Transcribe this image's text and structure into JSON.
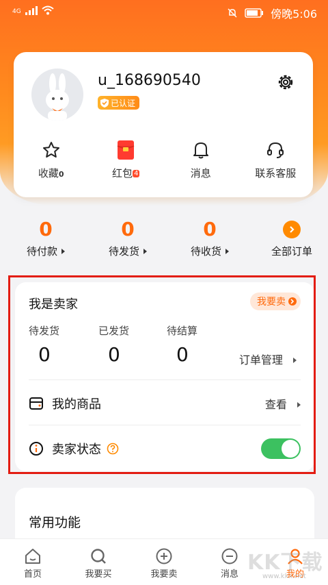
{
  "status_bar": {
    "network": "4G",
    "time": "傍晚5:06"
  },
  "profile": {
    "username": "u_168690540",
    "verified_label": "已认证"
  },
  "quick_actions": [
    {
      "label": "收藏",
      "count": "0",
      "icon": "star-icon"
    },
    {
      "label": "红包",
      "count": "4",
      "icon": "red-envelope-icon"
    },
    {
      "label": "消息",
      "count": "",
      "icon": "bell-icon"
    },
    {
      "label": "联系客服",
      "count": "",
      "icon": "headset-icon"
    }
  ],
  "orders": [
    {
      "count": "0",
      "label": "待付款"
    },
    {
      "count": "0",
      "label": "待发货"
    },
    {
      "count": "0",
      "label": "待收货"
    },
    {
      "count": "",
      "label": "全部订单"
    }
  ],
  "seller": {
    "title": "我是卖家",
    "sell_button": "我要卖",
    "stats": [
      {
        "label": "待发货",
        "value": "0"
      },
      {
        "label": "已发货",
        "value": "0"
      },
      {
        "label": "待结算",
        "value": "0"
      }
    ],
    "order_management": "订单管理",
    "my_goods": "我的商品",
    "view": "查看",
    "seller_status": "卖家状态",
    "status_on": true
  },
  "common": {
    "title": "常用功能"
  },
  "tabs": [
    {
      "label": "首页",
      "icon": "home-icon"
    },
    {
      "label": "我要买",
      "icon": "search-buy-icon"
    },
    {
      "label": "我要卖",
      "icon": "plus-circle-icon"
    },
    {
      "label": "消息",
      "icon": "chat-icon"
    },
    {
      "label": "我的",
      "icon": "user-icon"
    }
  ],
  "watermark": {
    "main": "KK下载",
    "sub": "www.kkx.net"
  },
  "colors": {
    "accent": "#ff6a0c",
    "toggle_on": "#3cc160",
    "highlight_frame": "#e31c12"
  }
}
